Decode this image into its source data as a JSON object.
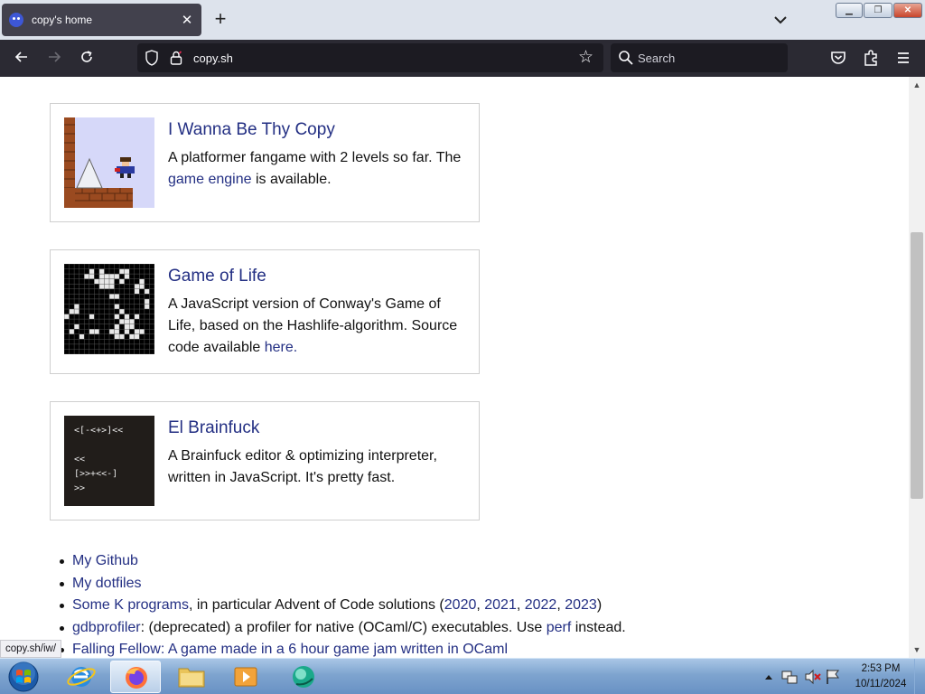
{
  "browser": {
    "tab_title": "copy's home",
    "tab_close": "✕",
    "new_tab": "+",
    "tab_list": "⌄",
    "url": "copy.sh",
    "search_placeholder": "Search",
    "status_url": "copy.sh/iw/"
  },
  "window": {
    "minimize": "▁",
    "maximize": "❐",
    "close": "✕"
  },
  "projects": [
    {
      "title": "I Wanna Be Thy Copy",
      "desc_before": "A platformer fangame with 2 levels so far. The ",
      "desc_link": "game engine",
      "desc_after": " is available."
    },
    {
      "title": "Game of Life",
      "desc_before": "A JavaScript version of Conway's Game of Life, based on the Hashlife-algorithm. Source code available ",
      "desc_link": "here.",
      "desc_after": ""
    },
    {
      "title": "El Brainfuck",
      "desc_before": "A Brainfuck editor & optimizing interpreter, written in JavaScript. It's pretty fast.",
      "thumb_lines": [
        "<[-<+>]<<",
        "",
        "<<",
        "[>>+<<-]",
        ">>"
      ]
    }
  ],
  "links": [
    {
      "link": "My Github",
      "text": ""
    },
    {
      "link": "My dotfiles",
      "text": ""
    },
    {
      "link": "Some K programs",
      "text": ", in particular Advent of Code solutions (",
      "years": [
        "2020",
        "2021",
        "2022",
        "2023"
      ],
      "text_end": ")"
    },
    {
      "link": "gdbprofiler",
      "text": ": (deprecated) a profiler for native (OCaml/C) executables. Use ",
      "link2": "perf",
      "text_end": " instead."
    },
    {
      "link": "Falling Fellow: A game made in a 6 hour game jam written in OCaml",
      "text": ""
    }
  ],
  "taskbar": {
    "time": "2:53 PM",
    "date": "10/11/2024"
  },
  "colors": {
    "link": "#232f83",
    "card_border": "#cfcfcf",
    "nav_bg": "#2b2a33"
  }
}
